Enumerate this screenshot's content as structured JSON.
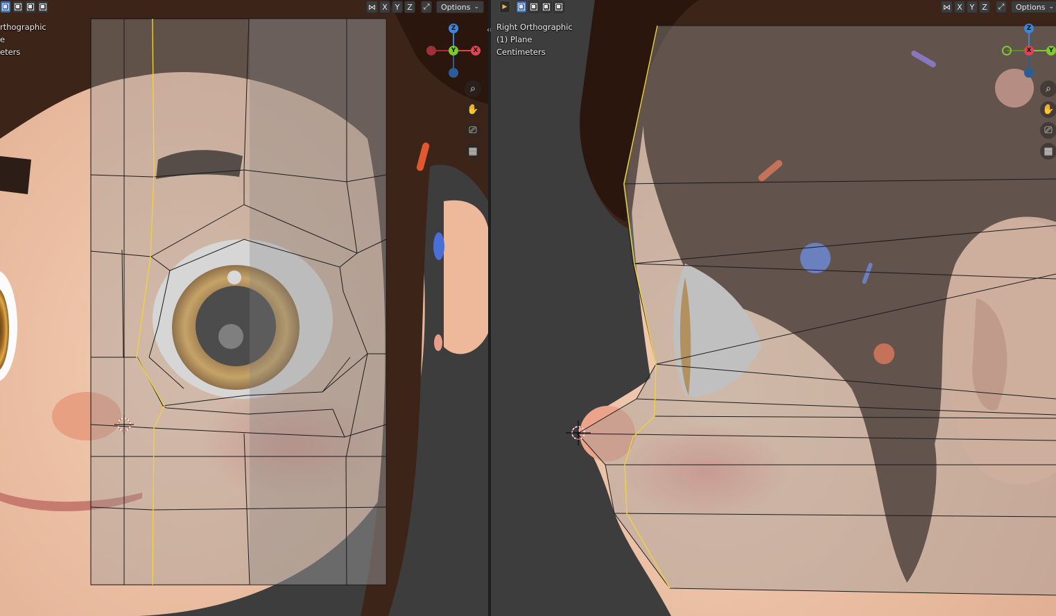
{
  "left_viewport": {
    "overlay_lines": [
      "rthographic",
      "e",
      "eters"
    ],
    "header": {
      "axis_buttons": [
        "X",
        "Y",
        "Z"
      ],
      "options_label": "Options",
      "options_chevron": "⌄"
    },
    "gizmo": {
      "z": "Z",
      "y": "Y",
      "x": "X"
    },
    "nav_icons": [
      "zoom-icon",
      "hand-icon",
      "camera-icon",
      "grid-icon"
    ]
  },
  "right_viewport": {
    "overlay_lines": [
      "Right Orthographic",
      "(1) Plane",
      "Centimeters"
    ],
    "header": {
      "axis_buttons": [
        "X",
        "Y",
        "Z"
      ],
      "options_label": "Options",
      "options_chevron": "⌄"
    },
    "gizmo": {
      "z": "Z",
      "x": "X",
      "y": "Y"
    },
    "nav_icons": [
      "zoom-icon",
      "hand-icon",
      "camera-icon",
      "grid-icon"
    ]
  },
  "colors": {
    "axis_x": "#e0454f",
    "axis_y": "#7ccb2a",
    "axis_z": "#3c86d8",
    "active_button": "#4772b3",
    "seam": "#f2d23a"
  },
  "glyphs": {
    "zoom": "⌕",
    "hand": "✋",
    "camera": "⎚",
    "grid": "▦",
    "split_arrows": "‹›"
  }
}
